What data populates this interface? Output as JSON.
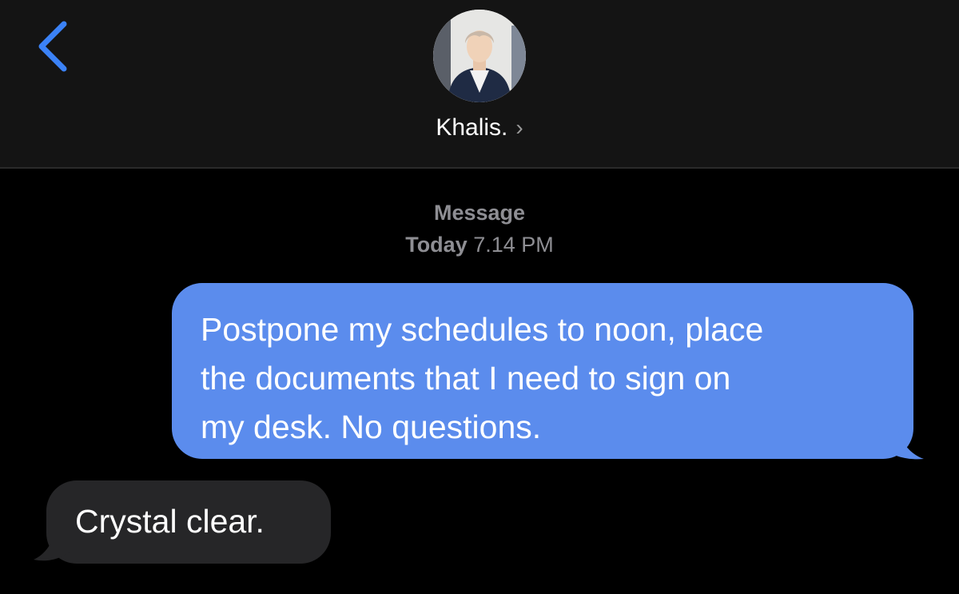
{
  "header": {
    "contact_name": "Khalis.",
    "chevron": "›",
    "back_icon": "chevron-left-icon",
    "accent_color": "#3b82f6"
  },
  "conversation": {
    "service_label": "Message",
    "timestamp_day": "Today",
    "timestamp_time": "7.14 PM",
    "messages": [
      {
        "direction": "sent",
        "text": "Postpone my schedules to noon, place\nthe documents that I need to sign on\nmy desk. No questions.",
        "bubble_color": "#5b8ced"
      },
      {
        "direction": "received",
        "text": "Crystal clear.",
        "bubble_color": "#262628"
      }
    ]
  }
}
